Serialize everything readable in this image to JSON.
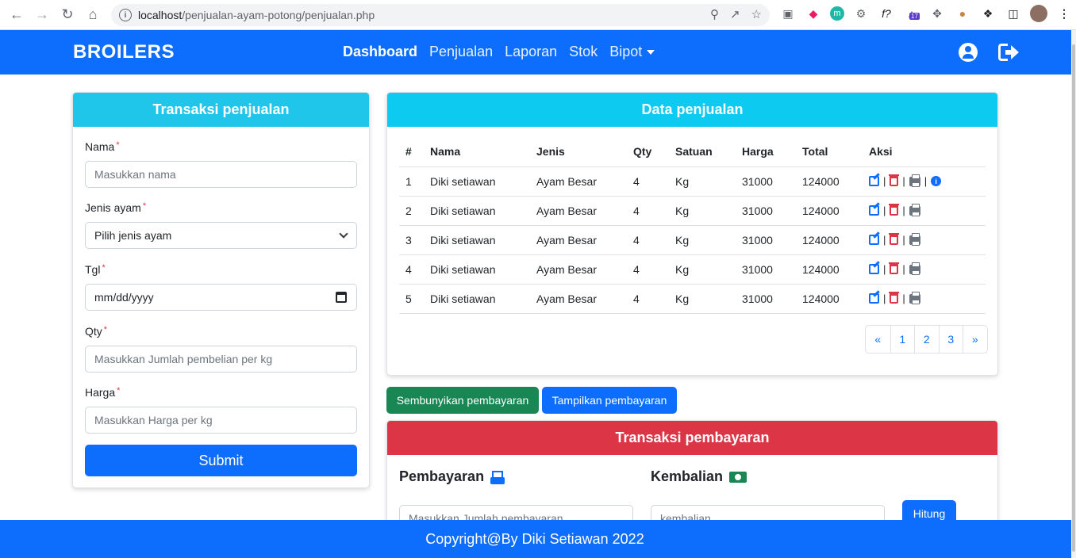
{
  "browser": {
    "url_host": "localhost",
    "url_path": "/penjualan-ayam-potong/penjualan.php",
    "extension_badge": "17"
  },
  "navbar": {
    "brand": "BROILERS",
    "items": [
      "Dashboard",
      "Penjualan",
      "Laporan",
      "Stok",
      "Bipot"
    ]
  },
  "form": {
    "title": "Transaksi penjualan",
    "required_mark": "*",
    "fields": [
      {
        "label": "Nama",
        "placeholder": "Masukkan nama"
      },
      {
        "label": "Jenis ayam",
        "value": "Pilih jenis ayam"
      },
      {
        "label": "Tgl",
        "value": "mm/dd/yyyy"
      },
      {
        "label": "Qty",
        "placeholder": "Masukkan Jumlah pembelian per kg"
      },
      {
        "label": "Harga",
        "placeholder": "Masukkan Harga per kg"
      }
    ],
    "submit_label": "Submit"
  },
  "table": {
    "title": "Data penjualan",
    "columns": [
      "#",
      "Nama",
      "Jenis",
      "Qty",
      "Satuan",
      "Harga",
      "Total",
      "Aksi"
    ],
    "rows": [
      [
        "1",
        "Diki setiawan",
        "Ayam Besar",
        "4",
        "Kg",
        "31000",
        "124000"
      ],
      [
        "2",
        "Diki setiawan",
        "Ayam Besar",
        "4",
        "Kg",
        "31000",
        "124000"
      ],
      [
        "3",
        "Diki setiawan",
        "Ayam Besar",
        "4",
        "Kg",
        "31000",
        "124000"
      ],
      [
        "4",
        "Diki setiawan",
        "Ayam Besar",
        "4",
        "Kg",
        "31000",
        "124000"
      ],
      [
        "5",
        "Diki setiawan",
        "Ayam Besar",
        "4",
        "Kg",
        "31000",
        "124000"
      ]
    ],
    "separator": "|",
    "pagination": [
      "«",
      "1",
      "2",
      "3",
      "»"
    ]
  },
  "buttons": {
    "hide_payment": "Sembunyikan pembayaran",
    "show_payment": "Tampilkan pembayaran"
  },
  "payment": {
    "title": "Transaksi pembayaran",
    "pembayaran_label": "Pembayaran",
    "kembalian_label": "Kembalian",
    "pembayaran_placeholder": "Masukkan Jumlah pembayaran",
    "kembalian_placeholder": "kembalian",
    "hitung_label": "Hitung"
  },
  "footer": {
    "text": "Copyright@By Diki Setiawan 2022"
  },
  "colors": {
    "primary": "#0d6efd",
    "info": "#0dcaf0",
    "success": "#198754",
    "danger": "#dc3545"
  }
}
